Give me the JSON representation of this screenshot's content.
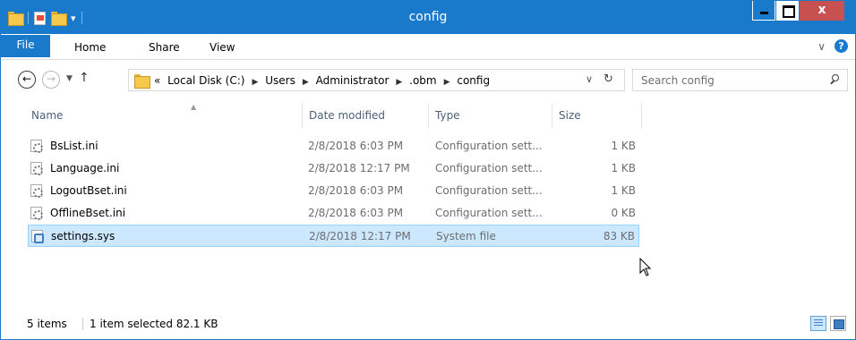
{
  "window": {
    "title": "config"
  },
  "title_controls": {
    "close_glyph": "x"
  },
  "ribbon": {
    "tabs": [
      "File",
      "Home",
      "Share",
      "View"
    ]
  },
  "address": {
    "overflow": "«",
    "crumbs": [
      "Local Disk (C:)",
      "Users",
      "Administrator",
      ".obm",
      "config"
    ]
  },
  "search": {
    "placeholder": "Search config"
  },
  "columns": {
    "name": "Name",
    "date": "Date modified",
    "type": "Type",
    "size": "Size"
  },
  "files": [
    {
      "name": "BsList.ini",
      "date": "2/8/2018 6:03 PM",
      "type": "Configuration sett...",
      "size": "1 KB"
    },
    {
      "name": "Language.ini",
      "date": "2/8/2018 12:17 PM",
      "type": "Configuration sett...",
      "size": "1 KB"
    },
    {
      "name": "LogoutBset.ini",
      "date": "2/8/2018 6:03 PM",
      "type": "Configuration sett...",
      "size": "1 KB"
    },
    {
      "name": "OfflineBset.ini",
      "date": "2/8/2018 6:03 PM",
      "type": "Configuration sett...",
      "size": "0 KB"
    },
    {
      "name": "settings.sys",
      "date": "2/8/2018 12:17 PM",
      "type": "System file",
      "size": "83 KB"
    }
  ],
  "status": {
    "items_count": "5 items",
    "selection": "1 item selected  82.1 KB"
  },
  "colors": {
    "accent": "#1979ca",
    "selection": "#cce8ff",
    "close": "#c75050"
  }
}
